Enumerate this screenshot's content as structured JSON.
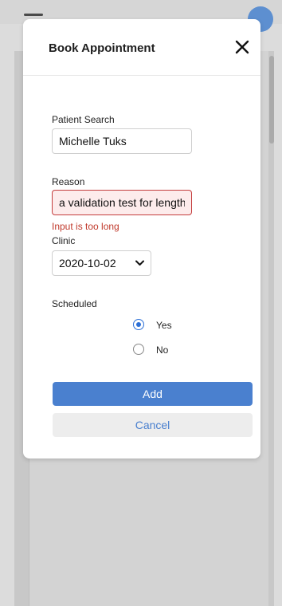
{
  "modal": {
    "title": "Book Appointment",
    "close_icon": "close-icon"
  },
  "form": {
    "patient_search": {
      "label": "Patient Search",
      "value": "Michelle Tuks"
    },
    "reason": {
      "label": "Reason",
      "value": "a validation test for length",
      "error": "Input is too long"
    },
    "clinic": {
      "label": "Clinic",
      "selected": "2020-10-02"
    },
    "scheduled": {
      "label": "Scheduled",
      "options": [
        {
          "label": "Yes",
          "checked": true
        },
        {
          "label": "No",
          "checked": false
        }
      ]
    }
  },
  "actions": {
    "add_label": "Add",
    "cancel_label": "Cancel"
  },
  "colors": {
    "primary": "#4a80cf",
    "error": "#c0392b"
  }
}
